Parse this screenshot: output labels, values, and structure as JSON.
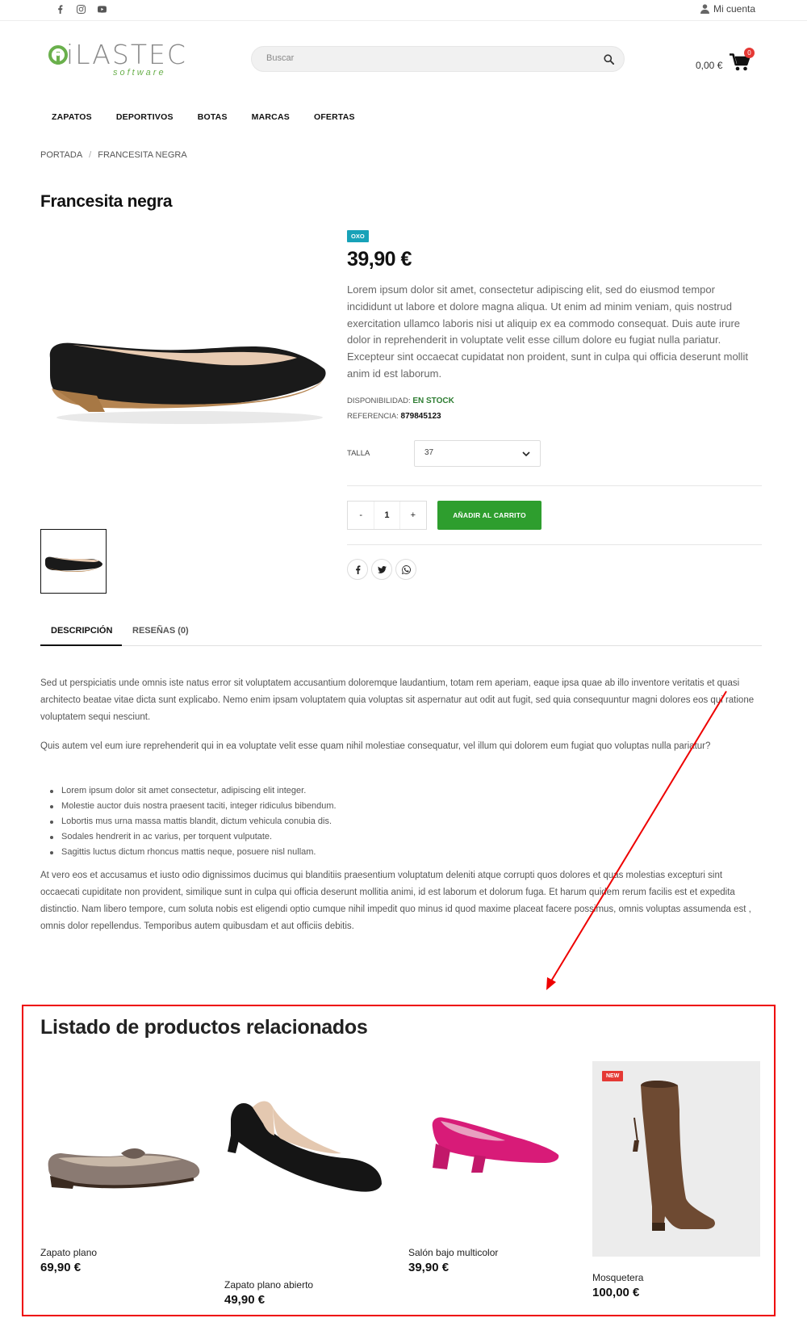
{
  "topbar": {
    "social": [
      "facebook-icon",
      "instagram-icon",
      "youtube-icon"
    ],
    "account_label": "Mi cuenta"
  },
  "header": {
    "logo_text": "iLASTEC",
    "logo_sub": "software",
    "search_placeholder": "Buscar",
    "cart_total": "0,00 €",
    "cart_count": "0"
  },
  "nav": [
    "ZAPATOS",
    "DEPORTIVOS",
    "BOTAS",
    "MARCAS",
    "OFERTAS"
  ],
  "breadcrumb": {
    "home": "PORTADA",
    "separator": "/",
    "current": "FRANCESITA NEGRA"
  },
  "product": {
    "title": "Francesita negra",
    "brand": "OXO",
    "price": "39,90 €",
    "short_description": "Lorem ipsum dolor sit amet, consectetur adipiscing elit, sed do eiusmod tempor incididunt ut labore et dolore magna aliqua. Ut enim ad minim veniam, quis nostrud exercitation ullamco laboris nisi ut aliquip ex ea commodo consequat. Duis aute irure dolor in reprehenderit in voluptate velit esse cillum dolore eu fugiat nulla pariatur. Excepteur sint occaecat cupidatat non proident, sunt in culpa qui officia deserunt mollit anim id est laborum.",
    "availability_label": "DISPONIBILIDAD:",
    "availability_value": "EN STOCK",
    "reference_label": "REFERENCIA:",
    "reference_value": "879845123",
    "size_label": "TALLA",
    "size_value": "37",
    "qty_minus": "-",
    "qty_value": "1",
    "qty_plus": "+",
    "add_to_cart": "AÑADIR AL CARRITO",
    "share": [
      "facebook-icon",
      "twitter-icon",
      "whatsapp-icon"
    ]
  },
  "tabs": [
    {
      "label": "DESCRIPCIÓN",
      "active": true
    },
    {
      "label": "RESEÑAS (0)",
      "active": false
    }
  ],
  "description": {
    "p1": "Sed ut perspiciatis unde omnis iste natus error sit voluptatem accusantium doloremque laudantium, totam rem aperiam, eaque ipsa quae ab illo inventore veritatis et quasi architecto beatae vitae dicta sunt explicabo. Nemo enim ipsam voluptatem quia voluptas sit aspernatur aut odit aut fugit, sed quia consequuntur magni dolores eos qui ratione voluptatem sequi nesciunt.",
    "p2": "Quis autem vel eum iure reprehenderit qui in ea voluptate velit esse quam nihil molestiae consequatur, vel illum qui dolorem eum fugiat quo voluptas nulla pariatur?",
    "list": [
      "Lorem ipsum dolor sit amet consectetur, adipiscing elit integer.",
      "Molestie auctor duis nostra praesent taciti, integer ridiculus bibendum.",
      "Lobortis mus urna massa mattis blandit, dictum vehicula conubia dis.",
      "Sodales hendrerit in ac varius, per torquent vulputate.",
      "Sagittis luctus dictum rhoncus mattis neque, posuere nisl nullam."
    ],
    "p3": "At vero eos et accusamus et iusto odio dignissimos ducimus qui blanditiis praesentium voluptatum deleniti atque corrupti quos dolores et quas molestias excepturi sint occaecati cupiditate non provident, similique sunt in culpa qui officia deserunt mollitia animi, id est laborum et dolorum fuga. Et harum quidem rerum facilis est et expedita distinctio. Nam libero tempore, cum soluta nobis est eligendi optio cumque nihil impedit quo minus id quod maxime placeat facere possimus, omnis voluptas assumenda est , omnis dolor repellendus. Temporibus autem quibusdam et aut officiis debitis."
  },
  "related": {
    "title": "Listado de productos relacionados",
    "items": [
      {
        "name": "Zapato plano",
        "price": "69,90 €"
      },
      {
        "name": "Zapato plano abierto",
        "price": "49,90 €"
      },
      {
        "name": "Salón bajo multicolor",
        "price": "39,90 €"
      },
      {
        "name": "Mosquetera",
        "price": "100,00 €",
        "badge": "NEW"
      }
    ]
  },
  "colors": {
    "accent_green": "#2e9e2e",
    "brand_tag": "#17a2b8",
    "highlight_red": "#e00000",
    "stock_green": "#2e7d32"
  }
}
